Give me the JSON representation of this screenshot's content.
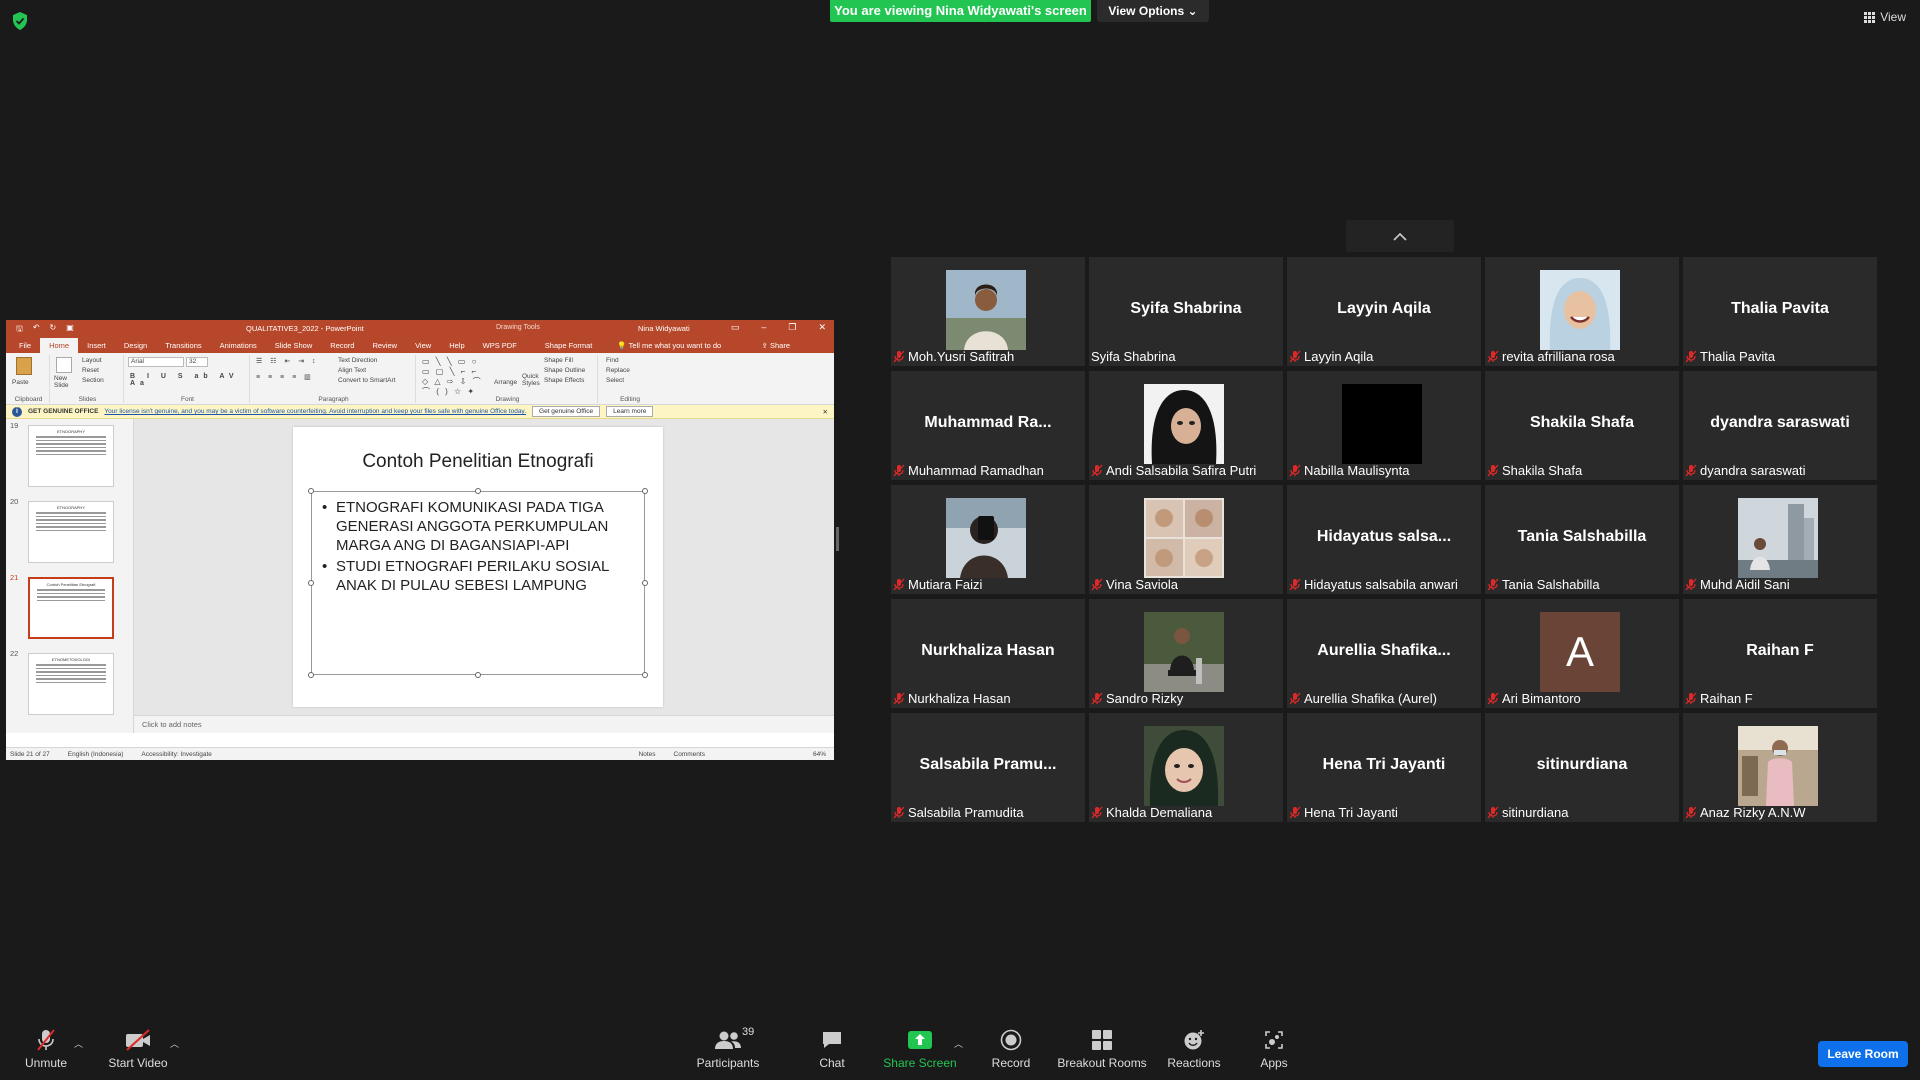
{
  "banner": {
    "viewing_text": "You are viewing Nina Widyawati's screen",
    "view_options": "View Options",
    "view_button": "View"
  },
  "ppt": {
    "window_title": "QUALITATIVE3_2022 - PowerPoint",
    "drawing_tools": "Drawing Tools",
    "user_name": "Nina Widyawati",
    "tabs": [
      "File",
      "Home",
      "Insert",
      "Design",
      "Transitions",
      "Animations",
      "Slide Show",
      "Record",
      "Review",
      "View",
      "Help",
      "WPS PDF"
    ],
    "format_tab": "Shape Format",
    "tell_me": "Tell me what you want to do",
    "share": "Share",
    "ribbon_groups": [
      "Clipboard",
      "Slides",
      "Font",
      "Paragraph",
      "Drawing",
      "Editing"
    ],
    "ribbon_items": {
      "paste": "Paste",
      "new_slide": "New Slide",
      "layout": "Layout",
      "reset": "Reset",
      "section": "Section",
      "font_name": "Arial",
      "font_size": "32",
      "text_direction": "Text Direction",
      "align_text": "Align Text",
      "convert_smartart": "Convert to SmartArt",
      "arrange": "Arrange",
      "quick_styles": "Quick Styles",
      "shape_fill": "Shape Fill",
      "shape_outline": "Shape Outline",
      "shape_effects": "Shape Effects",
      "find": "Find",
      "replace": "Replace",
      "select": "Select"
    },
    "notice": {
      "label": "GET GENUINE OFFICE",
      "message": "Your license isn't genuine, and you may be a victim of software counterfeiting. Avoid interruption and keep your files safe with genuine Office today.",
      "btn_genuine": "Get genuine Office",
      "btn_learn": "Learn more"
    },
    "thumbnails": [
      {
        "num": "19",
        "title": "ETNOGRAPHY",
        "selected": false
      },
      {
        "num": "20",
        "title": "ETNOGRAPHY",
        "selected": false
      },
      {
        "num": "21",
        "title": "Contoh Penelitian Etnografi",
        "selected": true
      },
      {
        "num": "22",
        "title": "ETNOMETODOLOGI",
        "selected": false
      }
    ],
    "slide": {
      "title": "Contoh Penelitian Etnografi",
      "bullets": [
        "ETNOGRAFI KOMUNIKASI PADA TIGA GENERASI ANGGOTA PERKUMPULAN MARGA ANG DI BAGANSIAPI-API",
        "STUDI ETNOGRAFI PERILAKU SOSIAL ANAK DI PULAU SEBESI LAMPUNG"
      ]
    },
    "notes_placeholder": "Click to add notes",
    "status": {
      "slide_count": "Slide 21 of 27",
      "language": "English (Indonesia)",
      "accessibility": "Accessibility: Investigate",
      "notes": "Notes",
      "comments": "Comments",
      "zoom": "64%"
    }
  },
  "participants": [
    {
      "display": "",
      "name": "Moh.Yusri Safitrah",
      "photo": "man-outdoor",
      "muted": true
    },
    {
      "display": "Syifa Shabrina",
      "name": "Syifa Shabrina",
      "photo": "",
      "muted": false
    },
    {
      "display": "Layyin Aqila",
      "name": "Layyin Aqila",
      "photo": "",
      "muted": true
    },
    {
      "display": "",
      "name": "revita afrilliana rosa",
      "photo": "hijab-smile",
      "muted": true
    },
    {
      "display": "Thalia Pavita",
      "name": "Thalia Pavita",
      "photo": "",
      "muted": true
    },
    {
      "display": "Muhammad  Ra...",
      "name": "Muhammad Ramadhan",
      "photo": "",
      "muted": true
    },
    {
      "display": "",
      "name": "Andi Salsabila Safira Putri",
      "photo": "hijab-dark",
      "muted": true
    },
    {
      "display": "",
      "name": "Nabilla Maulisynta",
      "photo": "black",
      "muted": true
    },
    {
      "display": "Shakila Shafa",
      "name": "Shakila Shafa",
      "photo": "",
      "muted": true
    },
    {
      "display": "dyandra saraswati",
      "name": "dyandra saraswati",
      "photo": "",
      "muted": true
    },
    {
      "display": "",
      "name": "Mutiara Faizi",
      "photo": "phone-selfie",
      "muted": true
    },
    {
      "display": "",
      "name": "Vina Saviola",
      "photo": "collage",
      "muted": true
    },
    {
      "display": "Hidayatus  salsa...",
      "name": "Hidayatus salsabila anwari",
      "photo": "",
      "muted": true
    },
    {
      "display": "Tania Salshabilla",
      "name": "Tania Salshabilla",
      "photo": "",
      "muted": true
    },
    {
      "display": "",
      "name": "Muhd Aidil Sani",
      "photo": "city",
      "muted": true
    },
    {
      "display": "Nurkhaliza Hasan",
      "name": "Nurkhaliza Hasan",
      "photo": "",
      "muted": true
    },
    {
      "display": "",
      "name": "Sandro Rizky",
      "photo": "man-sitting",
      "muted": true
    },
    {
      "display": "Aurellia  Shafika...",
      "name": "Aurellia Shafika (Aurel)",
      "photo": "",
      "muted": true
    },
    {
      "display": "A",
      "name": "Ari Bimantoro",
      "photo": "avatar-letter",
      "muted": true
    },
    {
      "display": "Raihan F",
      "name": "Raihan F",
      "photo": "",
      "muted": true
    },
    {
      "display": "Salsabila  Pramu...",
      "name": "Salsabila Pramudita",
      "photo": "",
      "muted": true
    },
    {
      "display": "",
      "name": "Khalda Demaliana",
      "photo": "hijab-face",
      "muted": true
    },
    {
      "display": "Hena Tri Jayanti",
      "name": "Hena Tri Jayanti",
      "photo": "",
      "muted": true
    },
    {
      "display": "sitinurdiana",
      "name": "sitinurdiana",
      "photo": "",
      "muted": true
    },
    {
      "display": "",
      "name": "Anaz Rizky A.N.W",
      "photo": "man-standing",
      "muted": true
    }
  ],
  "toolbar": {
    "unmute": "Unmute",
    "start_video": "Start Video",
    "participants": "Participants",
    "participant_count": "39",
    "chat": "Chat",
    "share_screen": "Share Screen",
    "record": "Record",
    "breakout_rooms": "Breakout Rooms",
    "reactions": "Reactions",
    "apps": "Apps",
    "leave_room": "Leave Room"
  },
  "colors": {
    "share_green": "#23c552",
    "leave_blue": "#0e71eb",
    "ppt_red": "#b7472a",
    "mute_red": "#e02828"
  }
}
